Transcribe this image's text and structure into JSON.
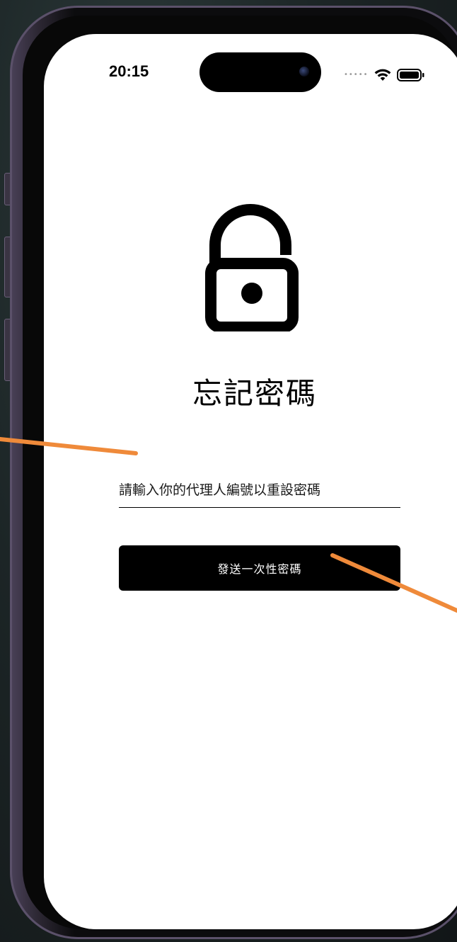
{
  "status_bar": {
    "time": "20:15"
  },
  "page": {
    "title": "忘記密碼",
    "icon": "unlock-icon"
  },
  "form": {
    "agent_id_placeholder": "請輸入你的代理人編號以重設密碼",
    "agent_id_value": "",
    "send_otp_label": "發送一次性密碼"
  },
  "colors": {
    "background": "#ffffff",
    "primary": "#000000",
    "button_text": "#ffffff",
    "annotation": "#ef8a3a"
  }
}
